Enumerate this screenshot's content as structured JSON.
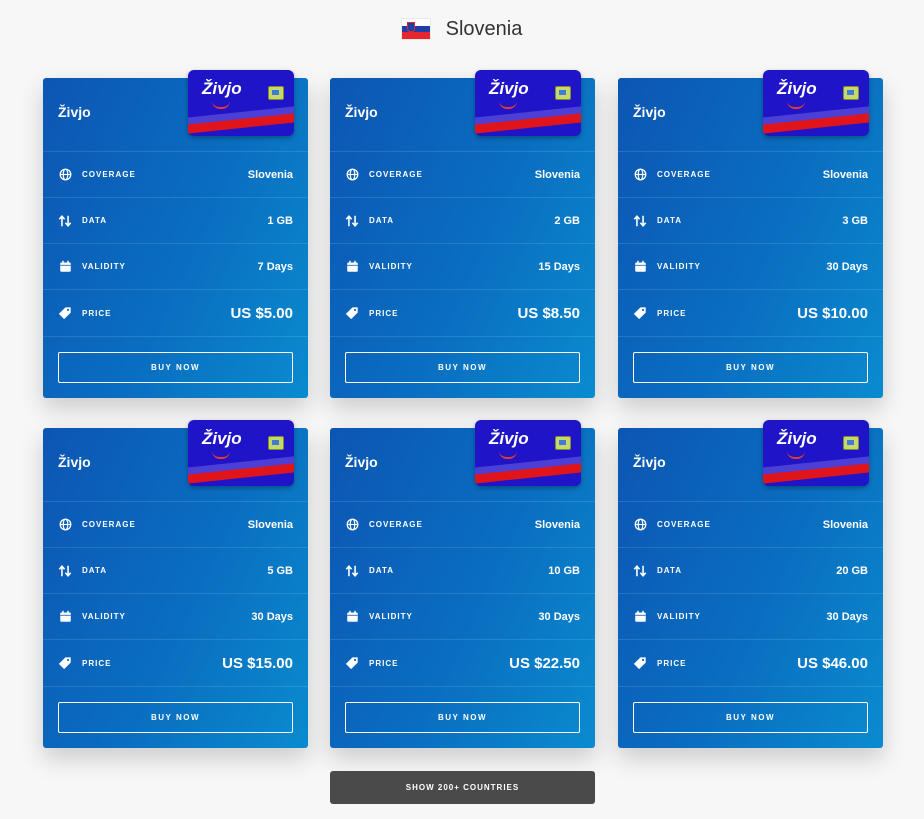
{
  "header": {
    "country": "Slovenia",
    "flag_icon": "slovenia-flag-icon"
  },
  "labels": {
    "coverage": "COVERAGE",
    "data": "DATA",
    "validity": "VALIDITY",
    "price": "PRICE",
    "buy": "BUY NOW"
  },
  "sim": {
    "logo": "Živjo"
  },
  "cards": [
    {
      "title": "Živjo",
      "coverage": "Slovenia",
      "data": "1 GB",
      "validity": "7 Days",
      "price": "US $5.00"
    },
    {
      "title": "Živjo",
      "coverage": "Slovenia",
      "data": "2 GB",
      "validity": "15 Days",
      "price": "US $8.50"
    },
    {
      "title": "Živjo",
      "coverage": "Slovenia",
      "data": "3 GB",
      "validity": "30 Days",
      "price": "US $10.00"
    },
    {
      "title": "Živjo",
      "coverage": "Slovenia",
      "data": "5 GB",
      "validity": "30 Days",
      "price": "US $15.00"
    },
    {
      "title": "Živjo",
      "coverage": "Slovenia",
      "data": "10 GB",
      "validity": "30 Days",
      "price": "US $22.50"
    },
    {
      "title": "Živjo",
      "coverage": "Slovenia",
      "data": "20 GB",
      "validity": "30 Days",
      "price": "US $46.00"
    }
  ],
  "footer": {
    "show_more": "SHOW 200+ COUNTRIES"
  },
  "colors": {
    "card_start": "#0c56b3",
    "card_end": "#0a8bcf",
    "sim_bg": "#1f14c8",
    "sim_red": "#e0141b",
    "button_dark": "#4a4a4a"
  }
}
